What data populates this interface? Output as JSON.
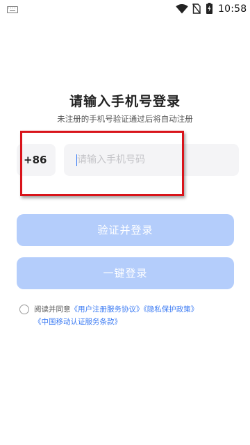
{
  "status_bar": {
    "time": "10:58",
    "icons": [
      "keyboard-icon",
      "wifi-icon",
      "no-sim-icon",
      "battery-charging-icon"
    ]
  },
  "login": {
    "title": "请输入手机号登录",
    "subtitle": "未注册的手机号验证通过后将自动注册",
    "country_code": "+86",
    "phone_value": "",
    "phone_placeholder": "请输入手机号码",
    "verify_button": "验证并登录",
    "onekey_button": "一键登录"
  },
  "agreement": {
    "checked": false,
    "prefix": "阅读并同意",
    "link_user": "《用户注册服务协议》",
    "link_privacy": "《隐私保护政策》",
    "link_cmcc": "《中国移动认证服务条款》"
  },
  "colors": {
    "primary_disabled": "#b4cdfb",
    "link": "#3a7af3",
    "highlight_frame": "#d9141b"
  }
}
